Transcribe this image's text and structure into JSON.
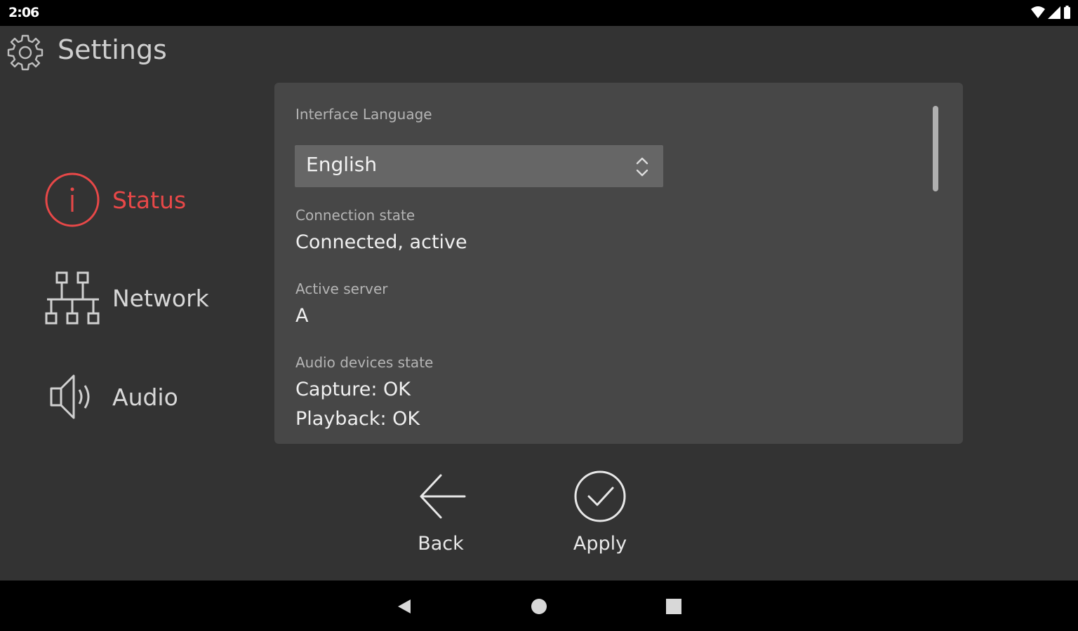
{
  "status_bar": {
    "time": "2:06"
  },
  "header": {
    "title": "Settings",
    "icon": "gear-icon"
  },
  "sidebar": {
    "items": [
      {
        "label": "Status",
        "icon": "info-icon",
        "active": true
      },
      {
        "label": "Network",
        "icon": "network-icon",
        "active": false
      },
      {
        "label": "Audio",
        "icon": "speaker-icon",
        "active": false
      }
    ]
  },
  "panel": {
    "language_label": "Interface Language",
    "language_value": "English",
    "connection_label": "Connection state",
    "connection_value": "Connected, active",
    "server_label": "Active server",
    "server_value": "A",
    "audio_label": "Audio devices state",
    "audio_capture": "Capture: OK",
    "audio_playback": "Playback: OK"
  },
  "actions": {
    "back_label": "Back",
    "apply_label": "Apply"
  },
  "colors": {
    "accent": "#e84848",
    "background": "#333333",
    "panel": "#474747",
    "select": "#666666"
  }
}
